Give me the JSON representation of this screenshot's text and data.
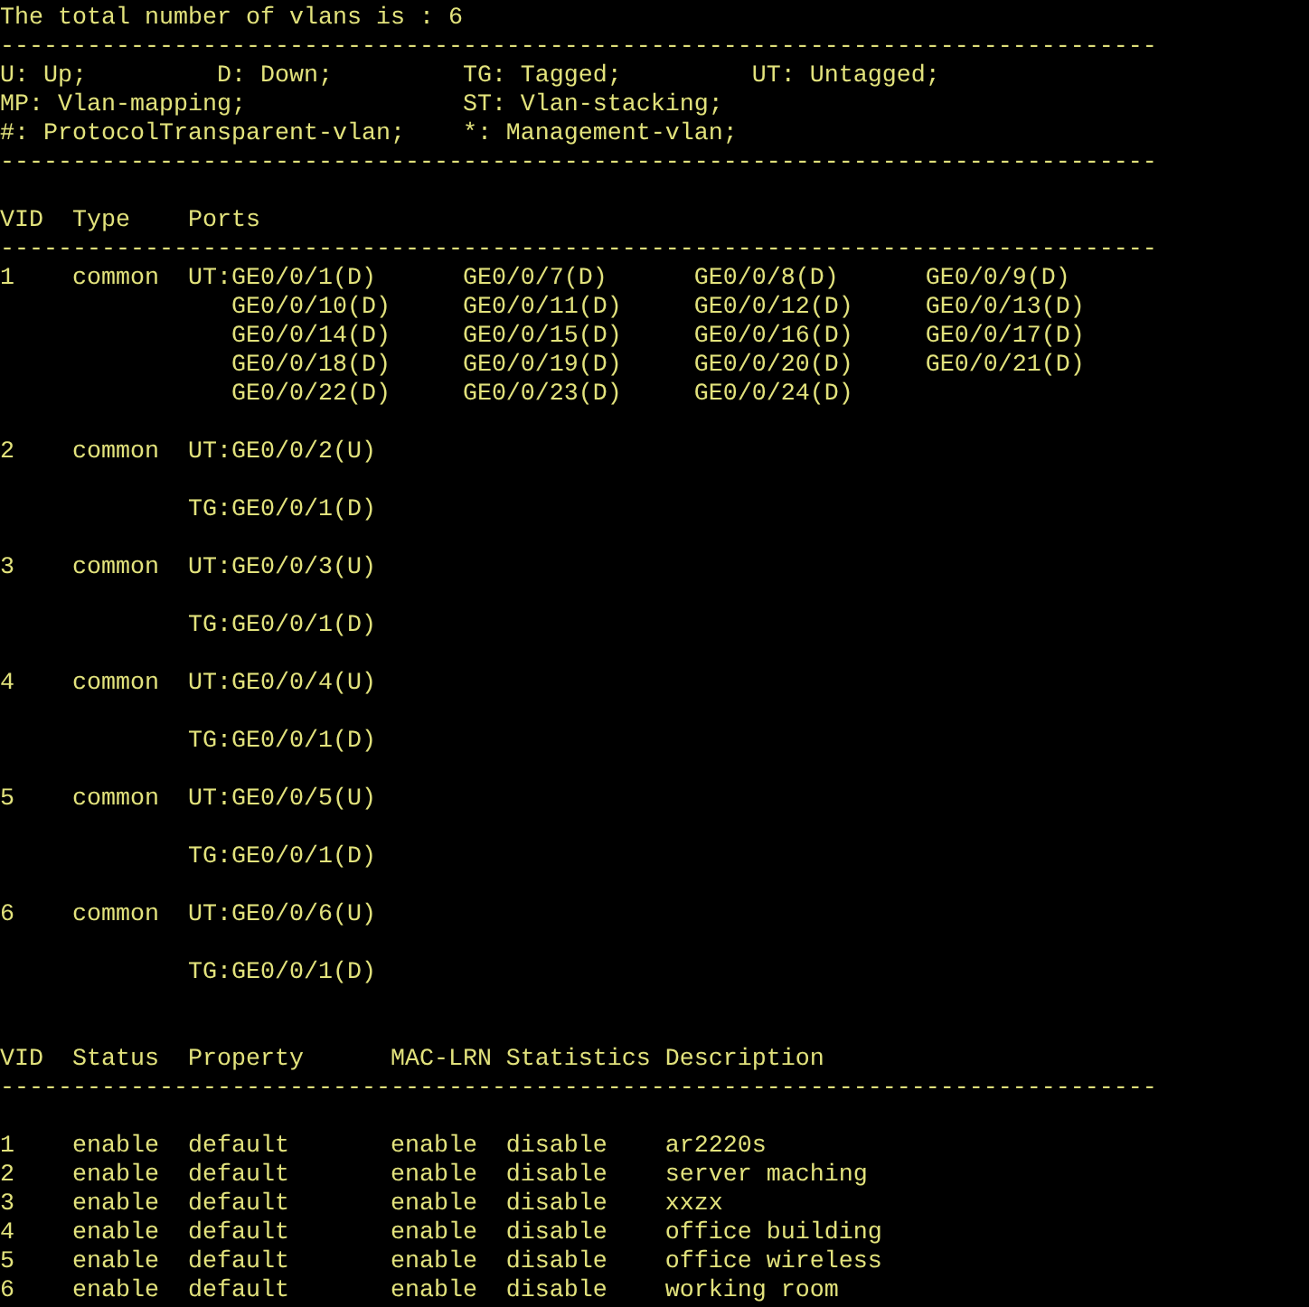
{
  "terminal": {
    "lines": [
      {
        "kind": "text",
        "text": "The total number of vlans is : 6"
      },
      {
        "kind": "text",
        "text": "--------------------------------------------------------------------------------"
      },
      {
        "kind": "text",
        "text": "U: Up;         D: Down;         TG: Tagged;         UT: Untagged;"
      },
      {
        "kind": "text",
        "text": "MP: Vlan-mapping;               ST: Vlan-stacking;"
      },
      {
        "kind": "text",
        "text": "#: ProtocolTransparent-vlan;    *: Management-vlan;"
      },
      {
        "kind": "text",
        "text": "--------------------------------------------------------------------------------"
      },
      {
        "kind": "blank"
      },
      {
        "kind": "text",
        "text": "VID  Type    Ports"
      },
      {
        "kind": "text",
        "text": "--------------------------------------------------------------------------------"
      },
      {
        "kind": "text",
        "text": "1    common  UT:GE0/0/1(D)      GE0/0/7(D)      GE0/0/8(D)      GE0/0/9(D)"
      },
      {
        "kind": "text",
        "text": "                GE0/0/10(D)     GE0/0/11(D)     GE0/0/12(D)     GE0/0/13(D)"
      },
      {
        "kind": "text",
        "text": "                GE0/0/14(D)     GE0/0/15(D)     GE0/0/16(D)     GE0/0/17(D)"
      },
      {
        "kind": "text",
        "text": "                GE0/0/18(D)     GE0/0/19(D)     GE0/0/20(D)     GE0/0/21(D)"
      },
      {
        "kind": "text",
        "text": "                GE0/0/22(D)     GE0/0/23(D)     GE0/0/24(D)"
      },
      {
        "kind": "blank"
      },
      {
        "kind": "text",
        "text": "2    common  UT:GE0/0/2(U)"
      },
      {
        "kind": "blank"
      },
      {
        "kind": "text",
        "text": "             TG:GE0/0/1(D)"
      },
      {
        "kind": "blank"
      },
      {
        "kind": "text",
        "text": "3    common  UT:GE0/0/3(U)"
      },
      {
        "kind": "blank"
      },
      {
        "kind": "text",
        "text": "             TG:GE0/0/1(D)"
      },
      {
        "kind": "blank"
      },
      {
        "kind": "text",
        "text": "4    common  UT:GE0/0/4(U)"
      },
      {
        "kind": "blank"
      },
      {
        "kind": "text",
        "text": "             TG:GE0/0/1(D)"
      },
      {
        "kind": "blank"
      },
      {
        "kind": "text",
        "text": "5    common  UT:GE0/0/5(U)"
      },
      {
        "kind": "blank"
      },
      {
        "kind": "text",
        "text": "             TG:GE0/0/1(D)"
      },
      {
        "kind": "blank"
      },
      {
        "kind": "text",
        "text": "6    common  UT:GE0/0/6(U)"
      },
      {
        "kind": "blank"
      },
      {
        "kind": "text",
        "text": "             TG:GE0/0/1(D)"
      },
      {
        "kind": "blank"
      },
      {
        "kind": "blank"
      },
      {
        "kind": "text",
        "text": "VID  Status  Property      MAC-LRN Statistics Description"
      },
      {
        "kind": "text",
        "text": "--------------------------------------------------------------------------------"
      },
      {
        "kind": "blank"
      },
      {
        "kind": "text",
        "text": "1    enable  default       enable  disable    ar2220s"
      },
      {
        "kind": "text",
        "text": "2    enable  default       enable  disable    server maching"
      },
      {
        "kind": "text",
        "text": "3    enable  default       enable  disable    xxzx"
      },
      {
        "kind": "text",
        "text": "4    enable  default       enable  disable    office building"
      },
      {
        "kind": "text",
        "text": "5    enable  default       enable  disable    office wireless"
      },
      {
        "kind": "text",
        "text": "6    enable  default       enable  disable    working room"
      }
    ]
  }
}
